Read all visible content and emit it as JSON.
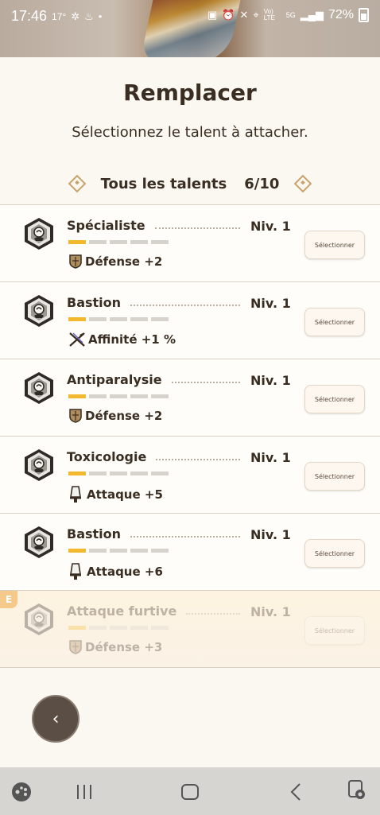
{
  "status_bar": {
    "time": "17:46",
    "temperature": "17°",
    "battery": "72%",
    "network_top": "Vo) LTE",
    "network_5g": "5G"
  },
  "header": {
    "title": "Remplacer",
    "subtitle": "Sélectionnez le talent à attacher."
  },
  "filter": {
    "label": "Tous les talents",
    "count": "6/10"
  },
  "talents": [
    {
      "name": "Spécialiste",
      "level": "Niv. 1",
      "stat": "Défense +2",
      "stat_icon": "shield-icon",
      "filled_bars": 1,
      "total_bars": 5,
      "button": "Sélectionner"
    },
    {
      "name": "Bastion",
      "level": "Niv. 1",
      "stat": "Affinité +1 %",
      "stat_icon": "crossed-blades-icon",
      "filled_bars": 1,
      "total_bars": 5,
      "button": "Sélectionner"
    },
    {
      "name": "Antiparalysie",
      "level": "Niv. 1",
      "stat": "Défense +2",
      "stat_icon": "shield-icon",
      "filled_bars": 1,
      "total_bars": 5,
      "button": "Sélectionner"
    },
    {
      "name": "Toxicologie",
      "level": "Niv. 1",
      "stat": "Attaque +5",
      "stat_icon": "blade-icon",
      "filled_bars": 1,
      "total_bars": 5,
      "button": "Sélectionner"
    },
    {
      "name": "Bastion",
      "level": "Niv. 1",
      "stat": "Attaque +6",
      "stat_icon": "blade-icon",
      "filled_bars": 1,
      "total_bars": 5,
      "button": "Sélectionner"
    },
    {
      "name": "Attaque furtive",
      "level": "Niv. 1",
      "stat": "Défense +3",
      "stat_icon": "shield-icon",
      "filled_bars": 1,
      "total_bars": 5,
      "button": "Sélectionner",
      "equipped_tag": "E"
    }
  ],
  "colors": {
    "accent_bar": "#f2b92e",
    "text": "#3a2d22",
    "background": "#fbf8f2"
  },
  "back_button_icon": "chevron-left-icon",
  "nav_icons": [
    "game-launcher-icon",
    "recent-apps-icon",
    "home-icon",
    "back-icon",
    "assistant-icon"
  ]
}
